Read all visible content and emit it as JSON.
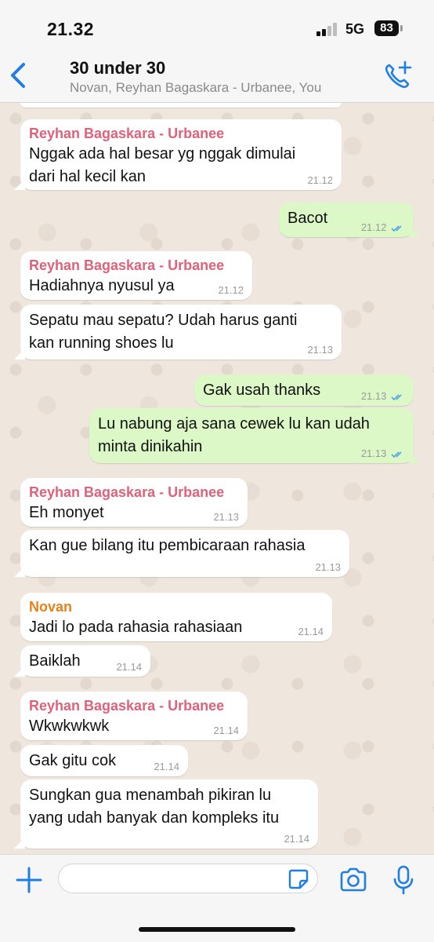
{
  "status_bar": {
    "time": "21.32",
    "network": "5G",
    "battery": "83"
  },
  "header": {
    "title": "30 under 30",
    "subtitle": "Novan, Reyhan Bagaskara - Urbanee, You"
  },
  "colors": {
    "accent": "#1f7ee6",
    "outgoing_bubble": "#dcf8c6",
    "incoming_bubble": "#ffffff",
    "sender_reyhan": "#e0617a",
    "sender_novan": "#e8811c",
    "read_ticks": "#4fa3e6"
  },
  "messages": [
    {
      "sender": "Reyhan Bagaskara - Urbanee",
      "text": "Nggak ada hal besar yg nggak dimulai\ndari hal kecil kan",
      "time": "21.12"
    },
    {
      "text": "Bacot",
      "time": "21.12",
      "read": true
    },
    {
      "sender": "Reyhan Bagaskara - Urbanee",
      "text": "Hadiahnya nyusul ya",
      "time": "21.12"
    },
    {
      "text": "Sepatu mau sepatu? Udah harus ganti\nkan running shoes lu",
      "time": "21.13"
    },
    {
      "text": "Gak usah thanks",
      "time": "21.13",
      "read": true
    },
    {
      "text": "Lu nabung aja sana cewek lu kan udah\nminta dinikahin",
      "time": "21.13",
      "read": true
    },
    {
      "sender": "Reyhan Bagaskara - Urbanee",
      "text": "Eh monyet",
      "time": "21.13"
    },
    {
      "text": "Kan gue bilang itu pembicaraan rahasia",
      "time": "21.13"
    },
    {
      "sender": "Novan",
      "text": "Jadi lo pada rahasia rahasiaan",
      "time": "21.14"
    },
    {
      "text": "Baiklah",
      "time": "21.14"
    },
    {
      "sender": "Reyhan Bagaskara - Urbanee",
      "text": "Wkwkwkwk",
      "time": "21.14"
    },
    {
      "text": "Gak gitu cok",
      "time": "21.14"
    },
    {
      "text": "Sungkan gua menambah pikiran lu\nyang udah banyak dan kompleks itu",
      "time": "21.14"
    }
  ],
  "input_bar": {
    "value": "",
    "placeholder": ""
  }
}
